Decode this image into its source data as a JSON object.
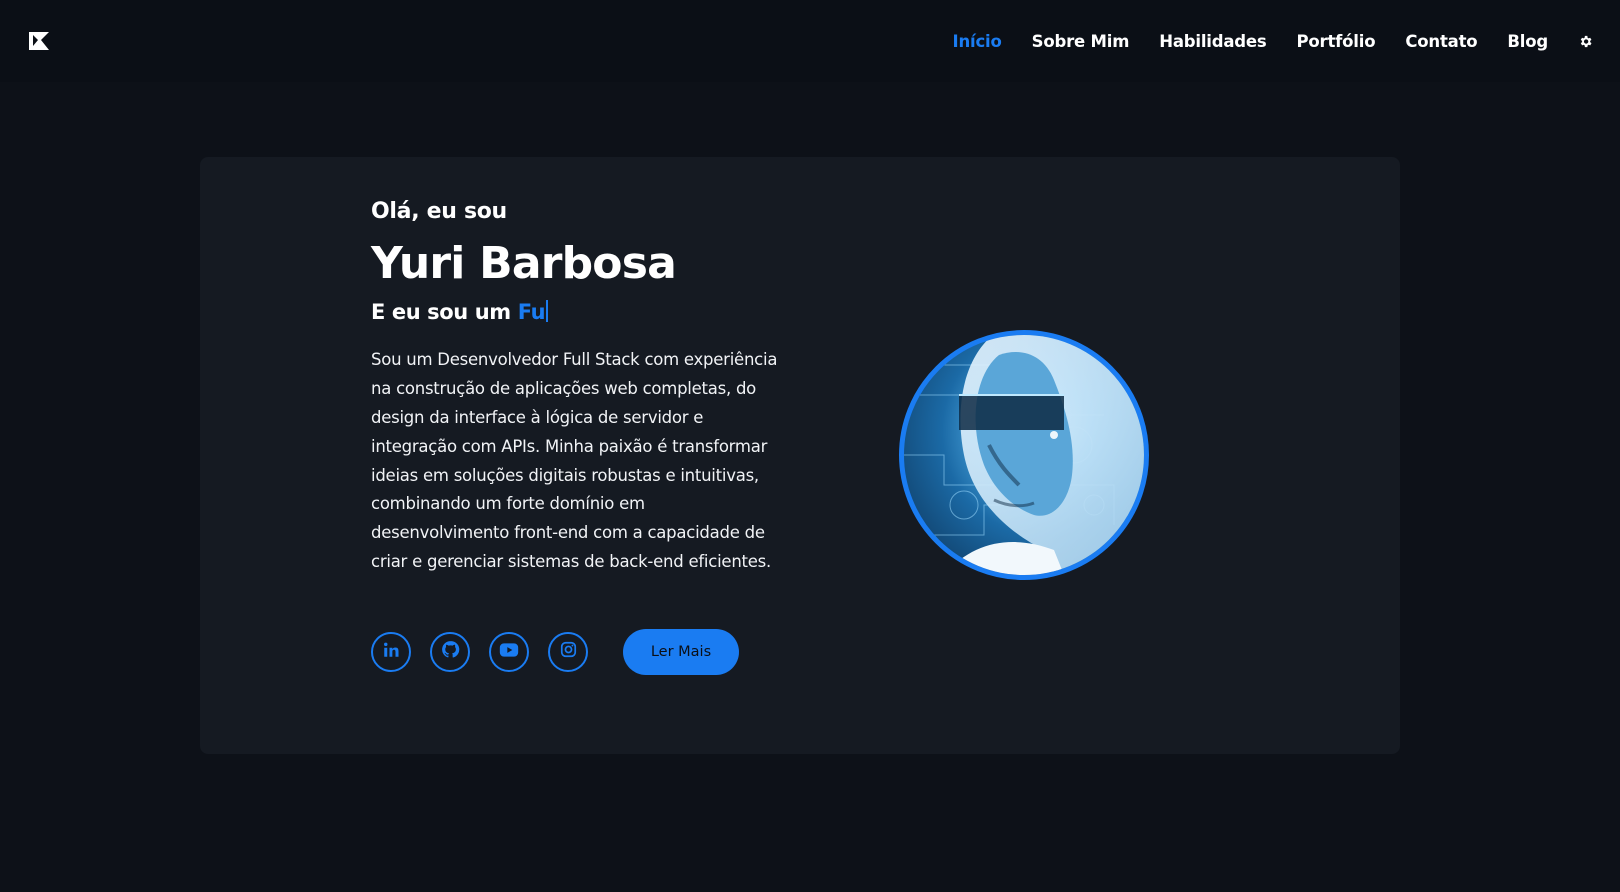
{
  "nav": {
    "logo_icon": "brand-logo-icon",
    "links": [
      {
        "label": "Início",
        "active": true
      },
      {
        "label": "Sobre Mim",
        "active": false
      },
      {
        "label": "Habilidades",
        "active": false
      },
      {
        "label": "Portfólio",
        "active": false
      },
      {
        "label": "Contato",
        "active": false
      },
      {
        "label": "Blog",
        "active": false
      }
    ],
    "settings_icon": "gear-icon"
  },
  "hero": {
    "greeting": "Olá, eu sou",
    "name": "Yuri Barbosa",
    "role_prefix": "E eu sou um ",
    "role_typed": "Fu",
    "bio": "Sou um Desenvolvedor Full Stack com experiência na construção de aplicações web completas, do design da interface à lógica de servidor e integração com APIs. Minha paixão é transformar ideias em soluções digitais robustas e intuitivas, combinando um forte domínio em desenvolvimento front-end com a capacidade de criar e gerenciar sistemas de back-end eficientes.",
    "social_icons": [
      "linkedin-icon",
      "github-icon",
      "youtube-icon",
      "instagram-icon"
    ],
    "cta_label": "Ler Mais"
  },
  "colors": {
    "accent": "#1a7cf2",
    "background": "#0d1118",
    "card": "#151a22",
    "navbar": "#0b0f16"
  }
}
